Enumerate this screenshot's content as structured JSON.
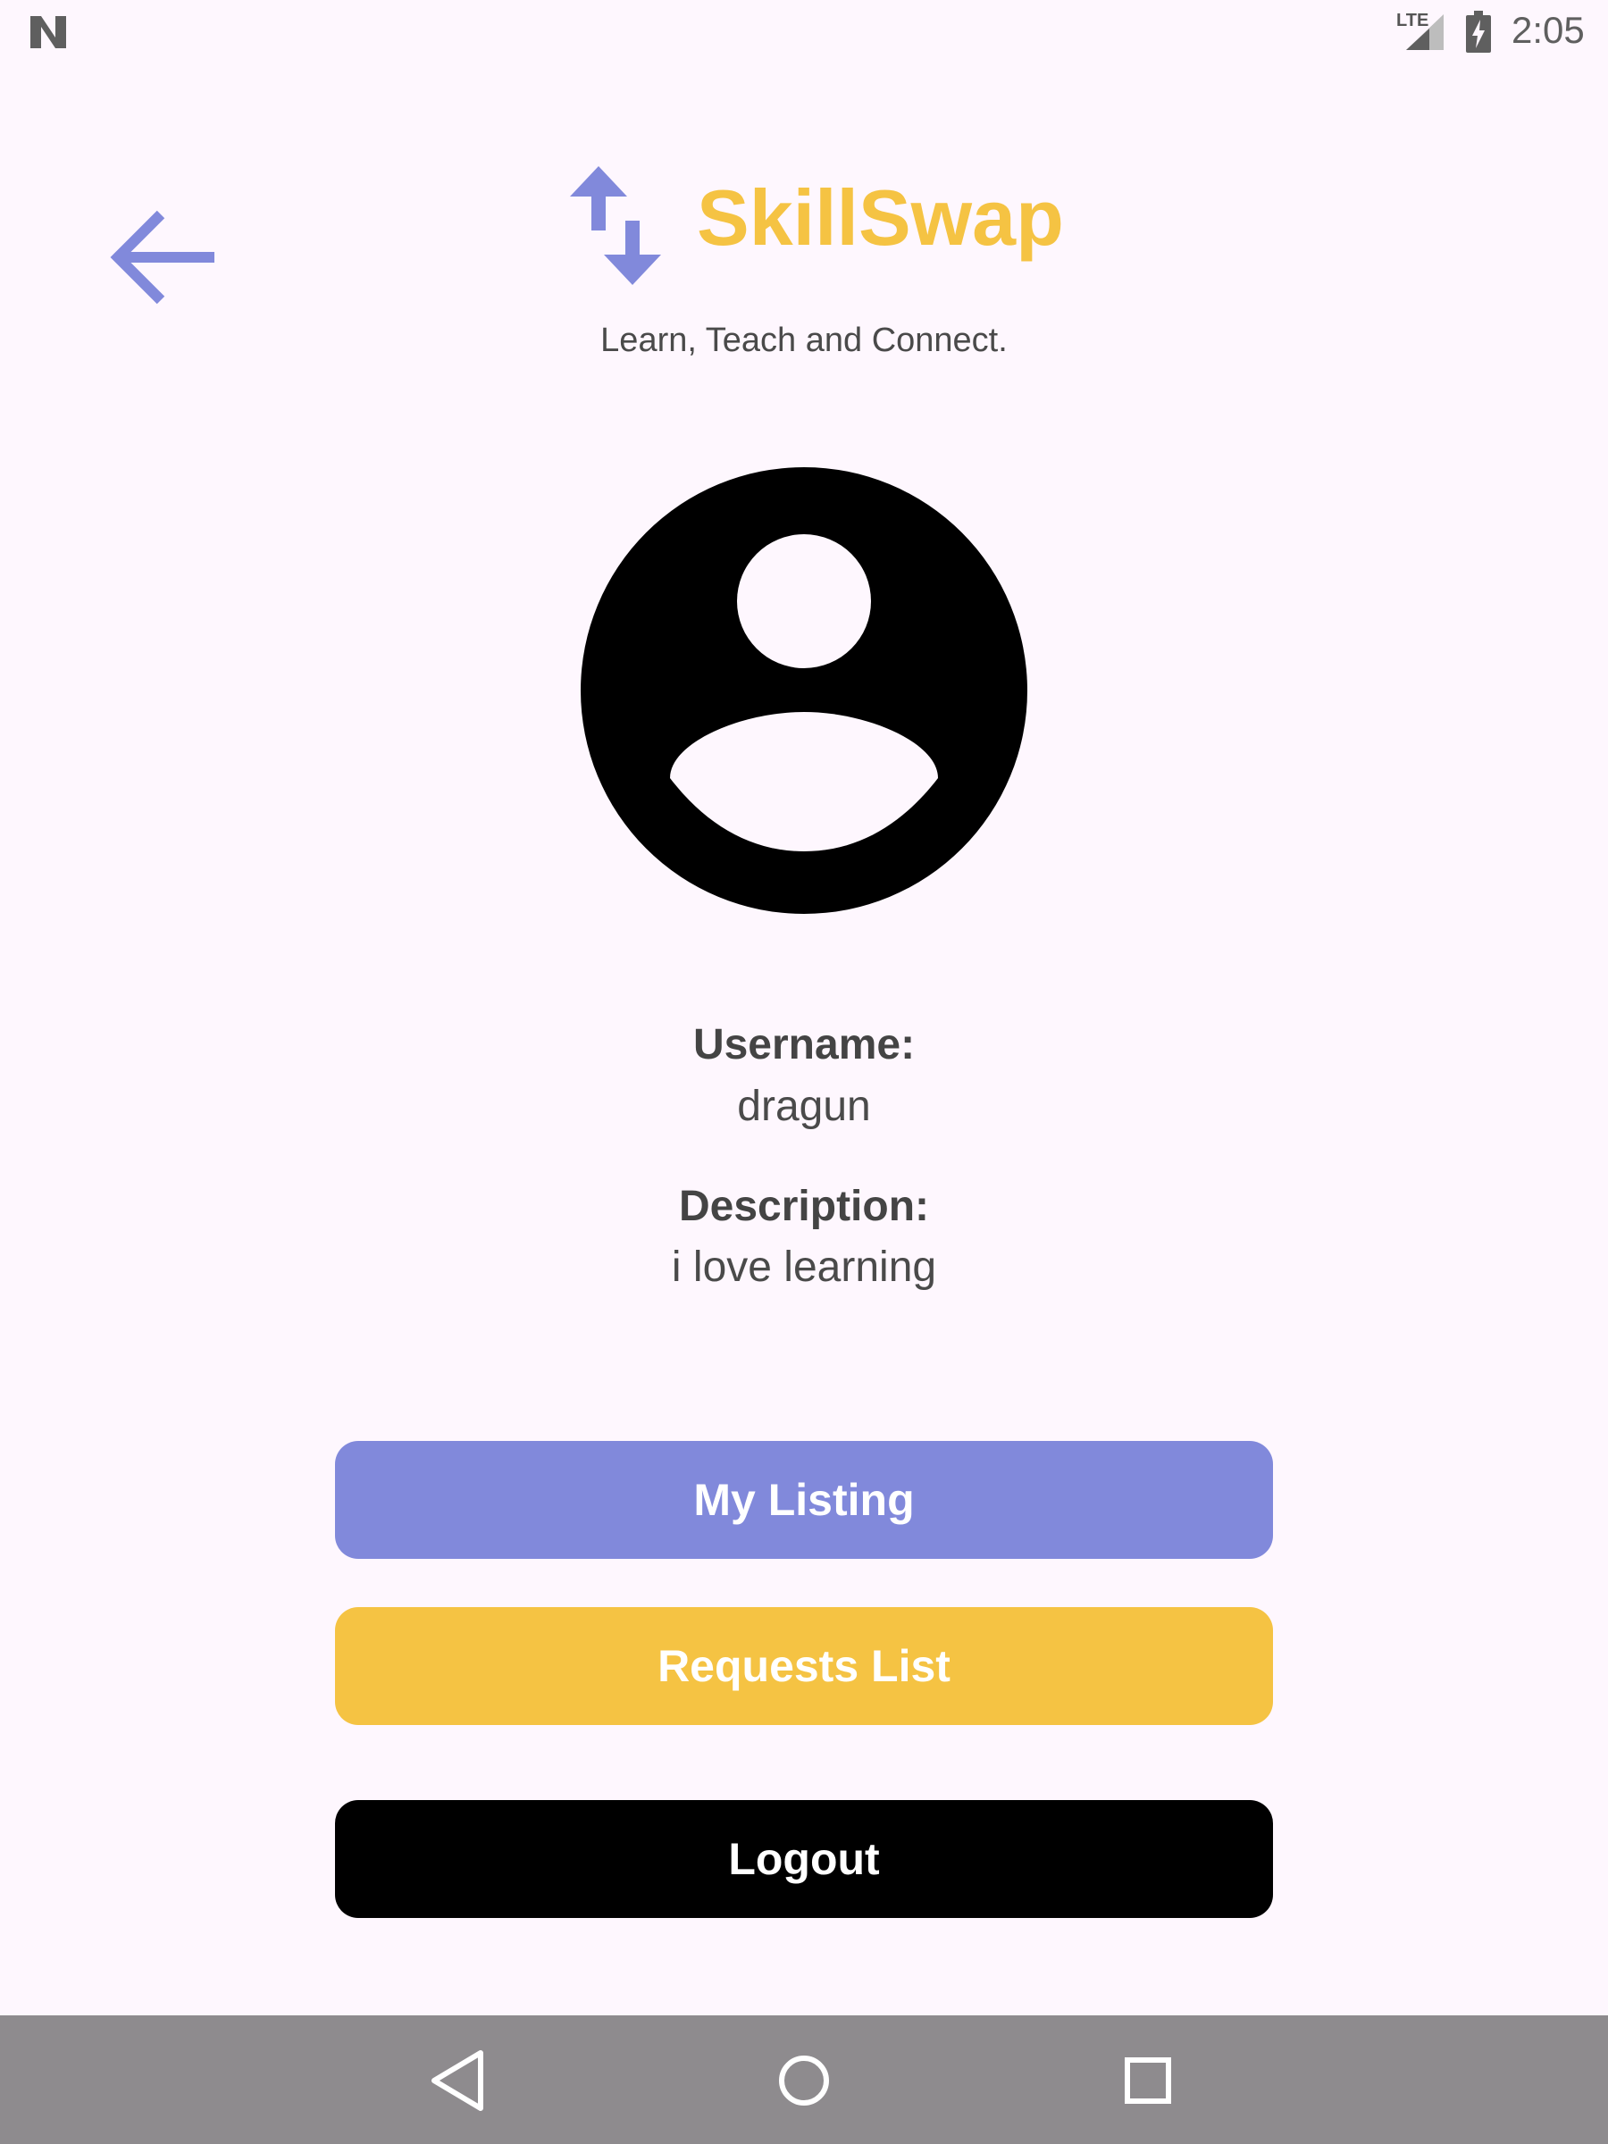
{
  "status_bar": {
    "time": "2:05",
    "network_label": "LTE",
    "icons": [
      "n-icon",
      "signal-icon",
      "battery-charging-icon"
    ]
  },
  "header": {
    "app_title": "SkillSwap",
    "tagline": "Learn, Teach and Connect.",
    "back_icon": "arrow-back-icon",
    "logo_icon": "swap-vert-icon"
  },
  "profile": {
    "avatar_icon": "account-circle-icon",
    "username_label": "Username:",
    "username_value": "dragun",
    "description_label": "Description:",
    "description_value": "i love learning"
  },
  "actions": {
    "my_listing_label": "My Listing",
    "requests_list_label": "Requests List",
    "logout_label": "Logout"
  },
  "navigation": {
    "icons": [
      "nav-back-icon",
      "nav-home-icon",
      "nav-recents-icon"
    ]
  },
  "colors": {
    "background": "#FEF7FE",
    "accent_purple": "#8189DB",
    "accent_yellow": "#F5C343",
    "logout_black": "#000000",
    "nav_bar_gray": "#8E8B8E"
  }
}
